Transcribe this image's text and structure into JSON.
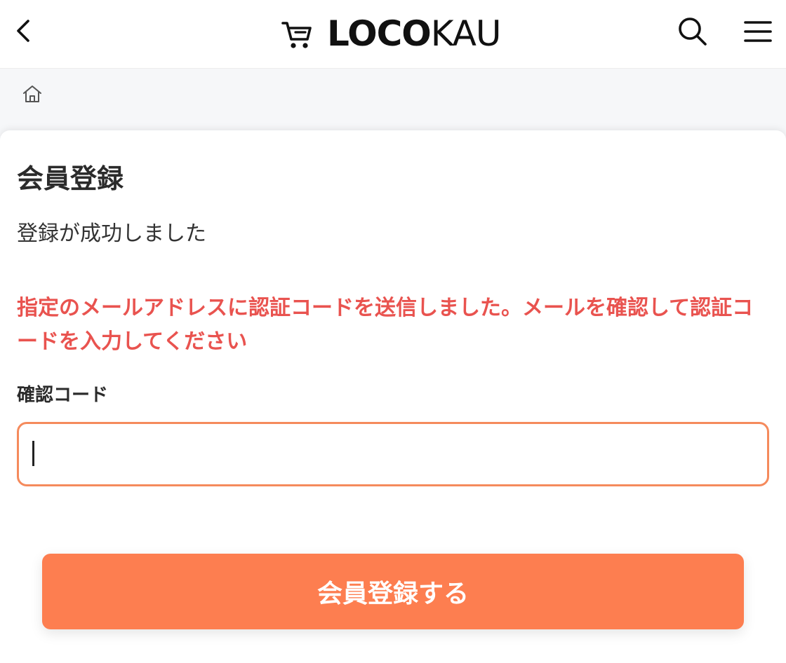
{
  "header": {
    "brand_bold": "LOCO",
    "brand_light": "KAU",
    "icons": {
      "back": "chevron-left-icon",
      "cart": "cart-icon",
      "search": "search-icon",
      "menu": "hamburger-menu-icon"
    }
  },
  "breadcrumb": {
    "icon": "home-icon"
  },
  "form": {
    "title": "会員登録",
    "success_message": "登録が成功しました",
    "notice": "指定のメールアドレスに認証コードを送信しました。メールを確認して認証コードを入力してください",
    "code_label": "確認コード",
    "code_value": "",
    "submit_label": "会員登録する"
  },
  "colors": {
    "accent": "#fd7e50",
    "input_border": "#f58a5c",
    "notice_text": "#e9534f",
    "page_background": "#f6f7f9"
  }
}
